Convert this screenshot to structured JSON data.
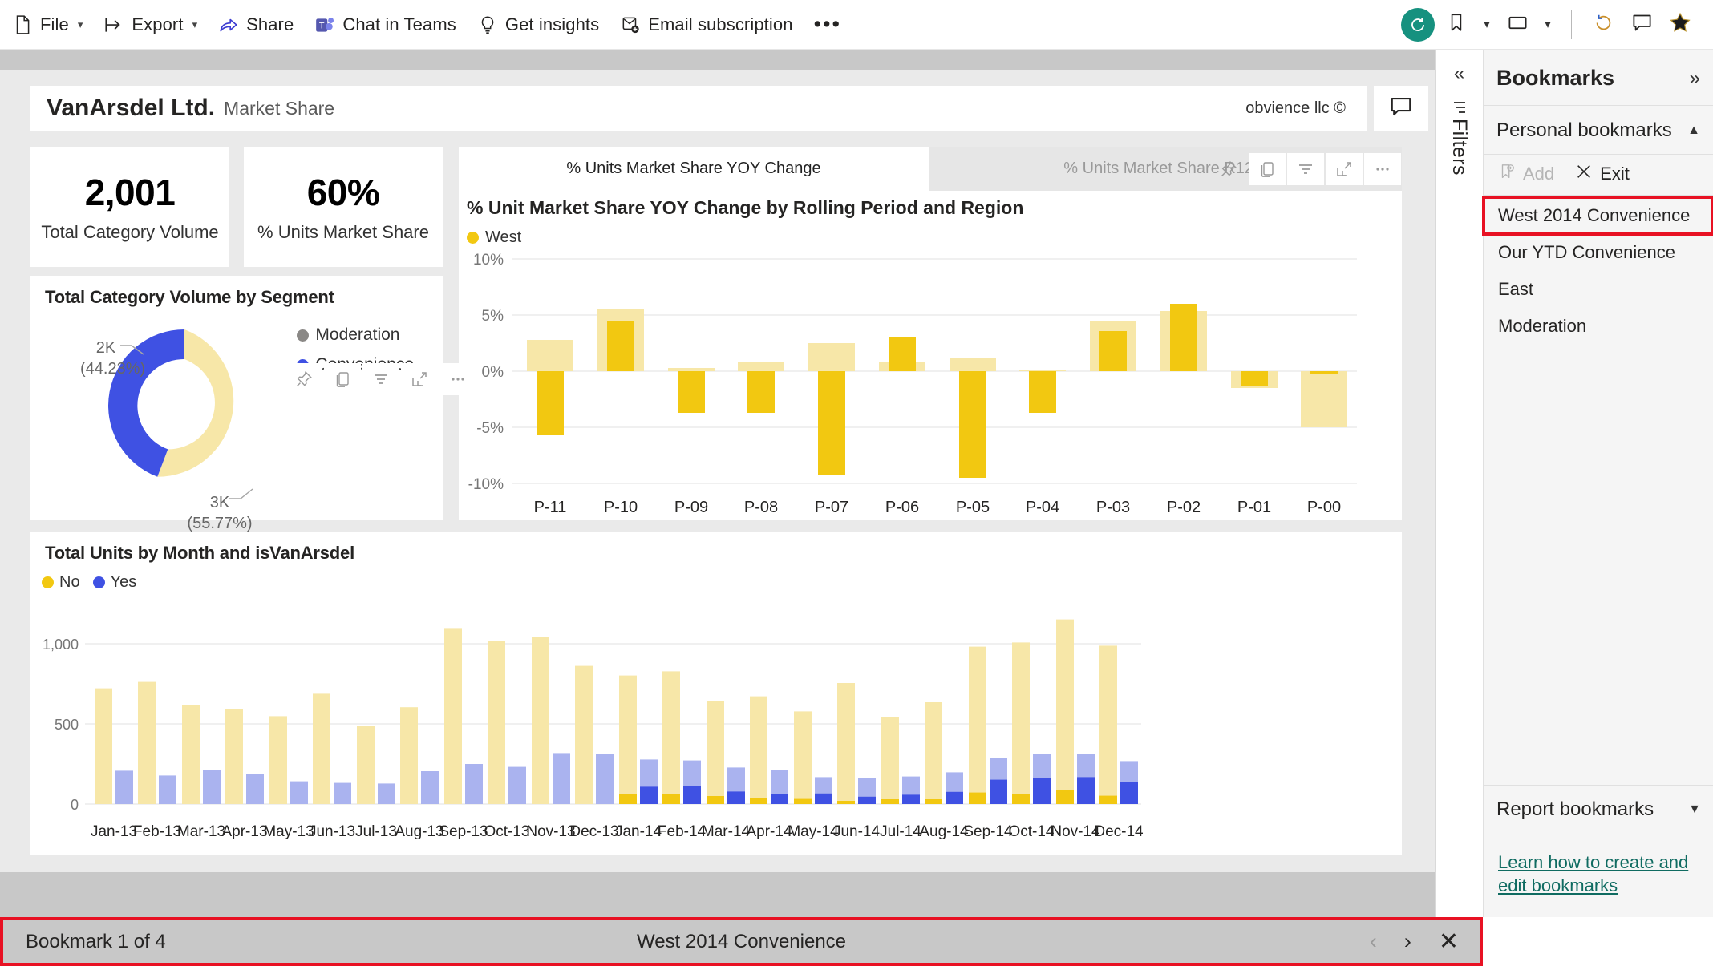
{
  "toolbar": {
    "items": [
      {
        "label": "File",
        "icon": "file-icon",
        "caret": true
      },
      {
        "label": "Export",
        "icon": "export-icon",
        "caret": true
      },
      {
        "label": "Share",
        "icon": "share-icon",
        "caret": false
      },
      {
        "label": "Chat in Teams",
        "icon": "teams-icon",
        "caret": false
      },
      {
        "label": "Get insights",
        "icon": "lightbulb-icon",
        "caret": false
      },
      {
        "label": "Email subscription",
        "icon": "email-subscription-icon",
        "caret": false
      }
    ],
    "more_label": "•••",
    "right": {
      "reset_icon": "reset-icon",
      "bookmark_icon": "bookmark-icon",
      "view_icon": "view-icon",
      "refresh_icon": "refresh-icon",
      "comment_icon": "comment-icon",
      "favorite_icon": "favorite-star-icon"
    }
  },
  "report": {
    "brand": "VanArsdel Ltd.",
    "subtitle": "Market Share",
    "copyright": "obvience llc ©",
    "kpis": [
      {
        "value": "2,001",
        "label": "Total Category Volume"
      },
      {
        "value": "60%",
        "label": "% Units Market Share"
      }
    ],
    "visual_actions": [
      "pin-icon",
      "copy-icon",
      "filter-icon",
      "focus-mode-icon",
      "more-options-icon"
    ],
    "tabs": [
      {
        "label": "% Units Market Share YOY Change",
        "active": true
      },
      {
        "label": "% Units Market Share R12M",
        "active": false
      }
    ]
  },
  "chart_data": [
    {
      "id": "donut",
      "type": "pie",
      "title": "Total Category Volume by Segment",
      "legend_position": "right",
      "categories": [
        "Moderation",
        "Convenience"
      ],
      "legend": [
        "Moderation",
        "Convenience"
      ],
      "colors": [
        "#8a8886",
        "#3f51e3"
      ],
      "slices": [
        {
          "name": "Convenience",
          "value": 2000,
          "label": "2K",
          "percent_label": "(44.23%)",
          "percent": 44.23,
          "color": "#3f51e3"
        },
        {
          "name": "Moderation",
          "value": 3000,
          "label": "3K",
          "percent_label": "(55.77%)",
          "percent": 55.77,
          "color": "#f7e7a8"
        }
      ]
    },
    {
      "id": "yoy",
      "type": "bar",
      "title": "% Unit Market Share YOY Change by Rolling Period and Region",
      "legend": [
        "West"
      ],
      "legend_colors": [
        "#f2c811"
      ],
      "xlabel": "",
      "ylabel": "",
      "ylim": [
        -10,
        10
      ],
      "yticks": [
        "10%",
        "5%",
        "0%",
        "-5%",
        "-10%"
      ],
      "categories": [
        "P-11",
        "P-10",
        "P-09",
        "P-08",
        "P-07",
        "P-06",
        "P-05",
        "P-04",
        "P-03",
        "P-02",
        "P-01",
        "P-00"
      ],
      "series": [
        {
          "name": "West (total)",
          "color": "#f7e7a8",
          "values": [
            2.8,
            5.6,
            0.3,
            0.8,
            2.5,
            0.8,
            1.2,
            0.1,
            4.5,
            5.4,
            -1.5,
            -5.0
          ]
        },
        {
          "name": "West (highlighted)",
          "color": "#f2c811",
          "values": [
            -5.7,
            4.5,
            -3.7,
            -3.7,
            -9.2,
            3.1,
            -9.5,
            -3.7,
            3.6,
            6.0,
            -1.3,
            -0.2
          ]
        }
      ]
    },
    {
      "id": "units",
      "type": "bar",
      "title": "Total Units by Month and isVanArsdel",
      "legend": [
        "No",
        "Yes"
      ],
      "legend_colors": [
        "#f2c811",
        "#3f51e3"
      ],
      "xlabel": "",
      "ylabel": "",
      "ylim": [
        0,
        1250
      ],
      "yticks": [
        "1,000",
        "500",
        "0"
      ],
      "categories": [
        "Jan-13",
        "Feb-13",
        "Mar-13",
        "Apr-13",
        "May-13",
        "Jun-13",
        "Jul-13",
        "Aug-13",
        "Sep-13",
        "Oct-13",
        "Nov-13",
        "Dec-13",
        "Jan-14",
        "Feb-14",
        "Mar-14",
        "Apr-14",
        "May-14",
        "Jun-14",
        "Jul-14",
        "Aug-14",
        "Sep-14",
        "Oct-14",
        "Nov-14",
        "Dec-14"
      ],
      "series": [
        {
          "name": "No (total)",
          "color": "#f7e7a8",
          "values": [
            722,
            762,
            620,
            595,
            548,
            688,
            485,
            604,
            1098,
            1018,
            1042,
            862,
            802,
            828,
            640,
            672,
            578,
            755,
            545,
            635,
            982,
            1008,
            1152,
            988
          ]
        },
        {
          "name": "Yes (total)",
          "color": "#aab3ef",
          "values": [
            208,
            178,
            215,
            188,
            142,
            132,
            128,
            205,
            250,
            232,
            318,
            312,
            278,
            272,
            228,
            212,
            168,
            162,
            172,
            198,
            290,
            312,
            312,
            268
          ]
        },
        {
          "name": "No (highlighted)",
          "color": "#f2c811",
          "values": [
            0,
            0,
            0,
            0,
            0,
            0,
            0,
            0,
            0,
            0,
            0,
            0,
            62,
            60,
            50,
            40,
            32,
            20,
            30,
            30,
            72,
            62,
            88,
            52
          ]
        },
        {
          "name": "Yes (highlighted)",
          "color": "#3f51e3",
          "values": [
            0,
            0,
            0,
            0,
            0,
            0,
            0,
            0,
            0,
            0,
            0,
            0,
            108,
            112,
            78,
            62,
            66,
            46,
            58,
            76,
            152,
            160,
            168,
            140
          ]
        }
      ]
    }
  ],
  "filters_rail": {
    "collapse_icon": "chevron-double-left-icon",
    "filter_icon": "filter-pane-icon",
    "label": "Filters"
  },
  "bookmarks_pane": {
    "title": "Bookmarks",
    "expand_icon": "chevron-double-right-icon",
    "personal_section": "Personal bookmarks",
    "add_label": "Add",
    "exit_label": "Exit",
    "items": [
      {
        "label": "West 2014 Convenience",
        "selected": true
      },
      {
        "label": "Our YTD Convenience",
        "selected": false
      },
      {
        "label": "East",
        "selected": false
      },
      {
        "label": "Moderation",
        "selected": false
      }
    ],
    "report_section": "Report bookmarks",
    "learn_link": "Learn how to create and edit bookmarks"
  },
  "bookmark_bar": {
    "counter": "Bookmark 1 of 4",
    "current": "West 2014 Convenience",
    "prev_icon": "chevron-left-icon",
    "next_icon": "chevron-right-icon",
    "close_icon": "close-icon"
  },
  "colors": {
    "accent_yellow": "#f2c811",
    "pale_yellow": "#f7e7a8",
    "accent_blue": "#3f51e3",
    "pale_blue": "#aab3ef",
    "selection_red": "#e81123",
    "teal": "#16917f"
  }
}
